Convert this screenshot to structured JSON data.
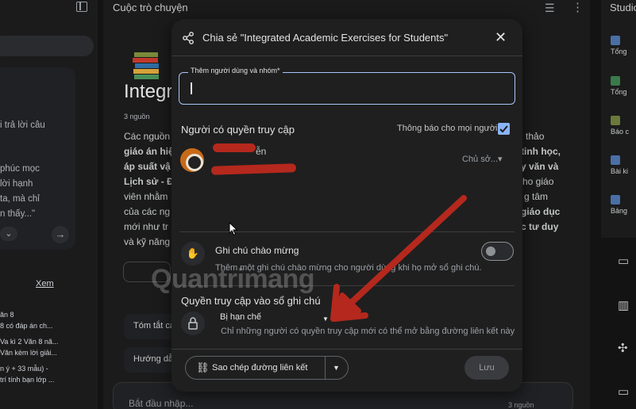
{
  "background": {
    "mid_title": "Cuộc trò chuyện",
    "studio_label": "Studio",
    "heading": "Integr",
    "sources_count": "3 nguồn",
    "left_lines": [
      "i trả lời câu",
      "phúc mọc",
      "lời hạnh",
      "ta, mà chỉ",
      "n thấy...\""
    ],
    "left_xem": "Xem",
    "left_list": [
      "ăn 8",
      "8 có đáp án ch...",
      "Va kì 2 Văn 8 nă...",
      "Văn kèm lời giải...",
      "n ý + 33 mẫu) -",
      "trí tính bạn lớp ..."
    ],
    "mid_lines": [
      {
        "text": "Các nguồn",
        "bold": false
      },
      {
        "text": "giáo án hiệ",
        "bold": true
      },
      {
        "text": "áp suất vậ",
        "bold": true
      },
      {
        "text": "Lịch sử - Đ",
        "bold": true
      },
      {
        "text": "viên nhằm",
        "bold": false
      },
      {
        "text": "của các ng",
        "bold": false
      },
      {
        "text": "mới như tr",
        "bold": false
      },
      {
        "text": "và kỹ năng",
        "bold": false
      }
    ],
    "mid_right_lines": [
      "n thảo",
      "tinh học,",
      "y văn và",
      "ho giáo",
      "g tâm",
      "giáo dục",
      "c tư duy"
    ],
    "q1": "Tóm tắt cá",
    "q2": "Hướng dẫ",
    "input_placeholder": "Bắt đầu nhập...",
    "input_sources": "3 nguồn",
    "studio_items": [
      "Tổng",
      "Tổng",
      "Báo c",
      "Bài ki",
      "Bảng"
    ],
    "watermark": "Quantrimang"
  },
  "modal": {
    "title": "Chia sẻ \"Integrated Academic Exercises for Students\"",
    "field_label": "Thêm người dùng và nhóm*",
    "field_value": "",
    "people_heading": "Người có quyền truy cập",
    "notify_label": "Thông báo cho mọi người",
    "notify_checked": true,
    "user_name": "ễn",
    "user_role": "Chủ sở...",
    "note_title": "Ghi chú chào mừng",
    "note_desc": "Thêm một ghi chú chào mừng cho người dùng khi họ mở sổ ghi chú.",
    "note_enabled": false,
    "access_heading": "Quyền truy cập vào sổ ghi chú",
    "access_value": "Bị hạn chế",
    "access_desc": "Chỉ những người có quyền truy cập mới có thể mở bằng đường liên kết này",
    "copy_label": "Sao chép đường liên kết",
    "save_label": "Lưu"
  },
  "colors": {
    "accent": "#8ab4f8",
    "annotation": "#b5281d",
    "modal_bg": "#1f1f1f"
  }
}
